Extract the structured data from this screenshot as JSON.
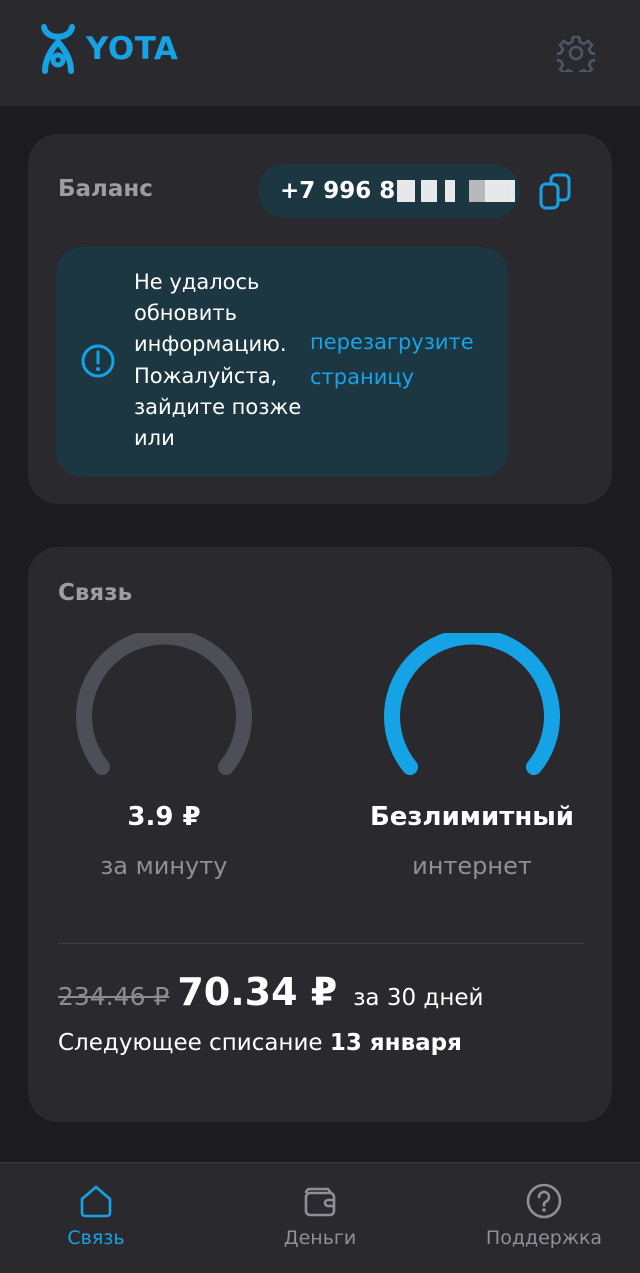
{
  "header": {
    "brand": "YOTA",
    "brand_color": "#16a3e6",
    "settings_icon": "gear-icon"
  },
  "balance": {
    "title": "Баланс",
    "phone_visible": "+7 996 8",
    "copy_icon": "copy-icon",
    "alert": {
      "icon": "exclamation-circle-icon",
      "message": "Не удалось обновить информацию. Пожалуйста, зайдите позже или",
      "link_text": "перезагрузите страницу"
    }
  },
  "communication": {
    "title": "Связь",
    "minutes": {
      "value": "3.9 ₽",
      "label": "за минуту",
      "level": 0,
      "color": "#4d4f56"
    },
    "internet": {
      "value": "Безлимитный",
      "label": "интернет",
      "level": 1,
      "color": "#16a3e6"
    },
    "old_price": "234.46 ₽",
    "new_price": "70.34 ₽",
    "period": "за 30 дней",
    "next_charge_label": "Следующее списание",
    "next_charge_date": "13 января"
  },
  "bottom_nav": {
    "items": [
      {
        "label": "Связь",
        "icon": "home-icon",
        "active": true
      },
      {
        "label": "Деньги",
        "icon": "wallet-icon",
        "active": false
      },
      {
        "label": "Поддержка",
        "icon": "help-circle-icon",
        "active": false
      }
    ],
    "active_color": "#16a3e6",
    "inactive_color": "#8f8f95"
  }
}
